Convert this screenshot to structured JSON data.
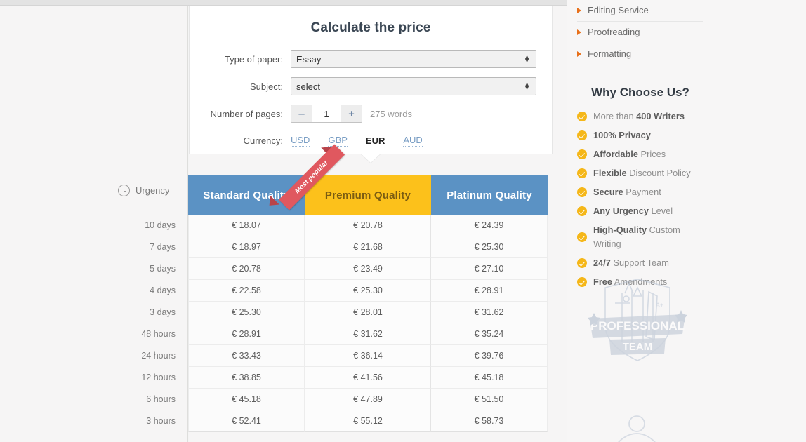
{
  "calculator": {
    "title": "Calculate the price",
    "fields": [
      {
        "label": "Type of paper:",
        "value": "Essay"
      },
      {
        "label": "Subject:",
        "value": "select"
      }
    ],
    "pages": {
      "label": "Number of pages:",
      "minus": "–",
      "plus": "+",
      "value": "1",
      "words": "275 words"
    },
    "currency": {
      "label": "Currency:",
      "options": [
        "USD",
        "GBP",
        "EUR",
        "AUD"
      ],
      "selected": "EUR"
    }
  },
  "pricing": {
    "urgency_label": "Urgency",
    "ribbon": "Most popular",
    "columns": [
      "Standard Quality",
      "Premium Quality",
      "Platinum Quality"
    ],
    "rows": [
      {
        "urgency": "10 days",
        "standard": "€ 18.07",
        "premium": "€ 20.78",
        "platinum": "€ 24.39"
      },
      {
        "urgency": "7 days",
        "standard": "€ 18.97",
        "premium": "€ 21.68",
        "platinum": "€ 25.30"
      },
      {
        "urgency": "5 days",
        "standard": "€ 20.78",
        "premium": "€ 23.49",
        "platinum": "€ 27.10"
      },
      {
        "urgency": "4 days",
        "standard": "€ 22.58",
        "premium": "€ 25.30",
        "platinum": "€ 28.91"
      },
      {
        "urgency": "3 days",
        "standard": "€ 25.30",
        "premium": "€ 28.01",
        "platinum": "€ 31.62"
      },
      {
        "urgency": "48 hours",
        "standard": "€ 28.91",
        "premium": "€ 31.62",
        "platinum": "€ 35.24"
      },
      {
        "urgency": "24 hours",
        "standard": "€ 33.43",
        "premium": "€ 36.14",
        "platinum": "€ 39.76"
      },
      {
        "urgency": "12 hours",
        "standard": "€ 38.85",
        "premium": "€ 41.56",
        "platinum": "€ 45.18"
      },
      {
        "urgency": "6 hours",
        "standard": "€ 45.18",
        "premium": "€ 47.89",
        "platinum": "€ 51.50"
      },
      {
        "urgency": "3 hours",
        "standard": "€ 52.41",
        "premium": "€ 55.12",
        "platinum": "€ 58.73"
      }
    ],
    "colors": {
      "standard": "#5b92c4",
      "premium": "#fcc11b",
      "ribbon": "#e0585f"
    }
  },
  "sidebar": {
    "services": [
      "Editing Service",
      "Proofreading",
      "Formatting"
    ],
    "why_title": "Why Choose Us?",
    "features": [
      {
        "pre": "More than ",
        "bold": "400 Writers",
        "post": ""
      },
      {
        "pre": "",
        "bold": "100% Privacy",
        "post": ""
      },
      {
        "pre": "",
        "bold": "Affordable",
        "post": " Prices"
      },
      {
        "pre": "",
        "bold": "Flexible",
        "post": " Discount Policy"
      },
      {
        "pre": "",
        "bold": "Secure",
        "post": " Payment"
      },
      {
        "pre": "",
        "bold": "Any Urgency",
        "post": " Level"
      },
      {
        "pre": "",
        "bold": "High-Quality",
        "post": " Custom Writing"
      },
      {
        "pre": "",
        "bold": "24/7",
        "post": " Support Team"
      },
      {
        "pre": "",
        "bold": "Free",
        "post": " Amendments"
      }
    ],
    "badge": {
      "top_text": "PROFESSIONAL",
      "bottom_text": "TEAM"
    }
  }
}
